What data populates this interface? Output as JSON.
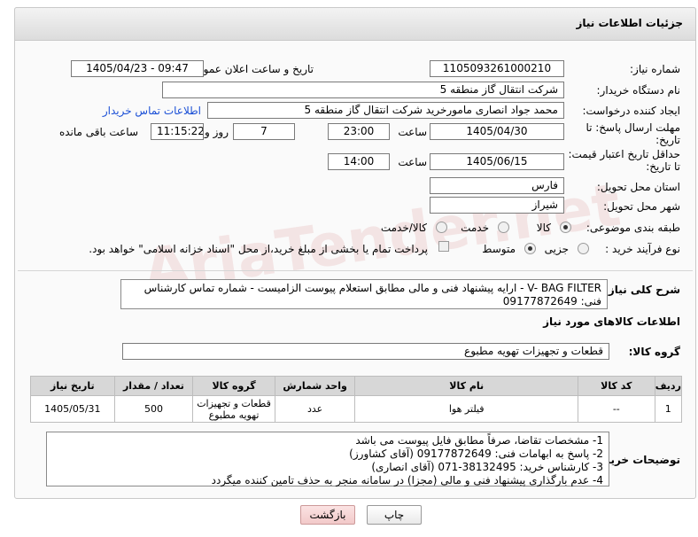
{
  "header": {
    "title": "جزئیات اطلاعات نیاز"
  },
  "form": {
    "need_number": {
      "label": "شماره نیاز:",
      "value": "1105093261000210"
    },
    "announce_datetime": {
      "label": "تاریخ و ساعت اعلان عمومی:",
      "value": "1405/04/23 - 09:47"
    },
    "buyer_org": {
      "label": "نام دستگاه خریدار:",
      "value": "شرکت انتقال گاز منطقه 5"
    },
    "creator": {
      "label": "ایجاد کننده درخواست:",
      "value": "محمد جواد انصاری مامورخرید شرکت انتقال گاز منطقه 5",
      "contact_link": "اطلاعات تماس خریدار"
    },
    "reply_deadline": {
      "label": "مهلت ارسال پاسخ: تا تاریخ:",
      "date": "1405/04/30",
      "time_label": "ساعت",
      "time": "23:00",
      "days": "7",
      "days_label": "روز و",
      "remaining": "11:15:22",
      "remaining_label": "ساعت باقی مانده"
    },
    "price_validity": {
      "label": "حداقل تاریخ اعتبار قیمت: تا تاریخ:",
      "date": "1405/06/15",
      "time_label": "ساعت",
      "time": "14:00"
    },
    "province": {
      "label": "استان محل تحویل:",
      "value": "فارس"
    },
    "city": {
      "label": "شهر محل تحویل:",
      "value": "شیراز"
    },
    "category": {
      "label": "طبقه بندی موضوعی:",
      "opt1": "کالا",
      "opt2": "خدمت",
      "opt3": "کالا/خدمت"
    },
    "purchase_type": {
      "label": "نوع فرآیند خرید :",
      "opt1": "جزیی",
      "opt2": "متوسط",
      "note": "پرداخت تمام یا بخشی از مبلغ خرید،از محل \"اسناد خزانه اسلامی\" خواهد بود."
    },
    "description": {
      "label": "شرح کلی نیاز:",
      "line1": "V- BAG FILTER - ارایه پیشنهاد فنی و مالی مطابق استعلام پیوست الزامیست - شماره تماس کارشناس",
      "line2": "فنی: 09177872649"
    }
  },
  "goods": {
    "section_title": "اطلاعات کالاهای مورد نیاز",
    "group_label": "گروه کالا:",
    "group_value": "قطعات و تجهیزات تهویه مطبوع",
    "columns": [
      "ردیف",
      "کد کالا",
      "نام کالا",
      "واحد شمارش",
      "گروه کالا",
      "تعداد / مقدار",
      "تاریخ نیاز"
    ],
    "rows": [
      {
        "row": "1",
        "code": "--",
        "name": "فیلتر هوا",
        "unit": "عدد",
        "group": "قطعات و تجهیزات تهویه مطبوع",
        "qty": "500",
        "date": "1405/05/31"
      }
    ]
  },
  "buyer_notes": {
    "label": "توضیحات خریدار:",
    "lines": [
      "1-  مشخصات تقاضا، صرفاً مطابق فایل پیوست می باشد",
      "2- پاسخ به ابهامات فنی: 09177872649 (آقای کشاورز)",
      "3- کارشناس خرید: 38132495-071 (آقای انصاری)",
      "4- عدم بارگذاری پیشنهاد فنی و مالی (مجزا) در سامانه منجر به حذف تامین کننده میگردد"
    ]
  },
  "buttons": {
    "print": "چاپ",
    "back": "بازگشت"
  },
  "watermark": "AriaTender.net"
}
